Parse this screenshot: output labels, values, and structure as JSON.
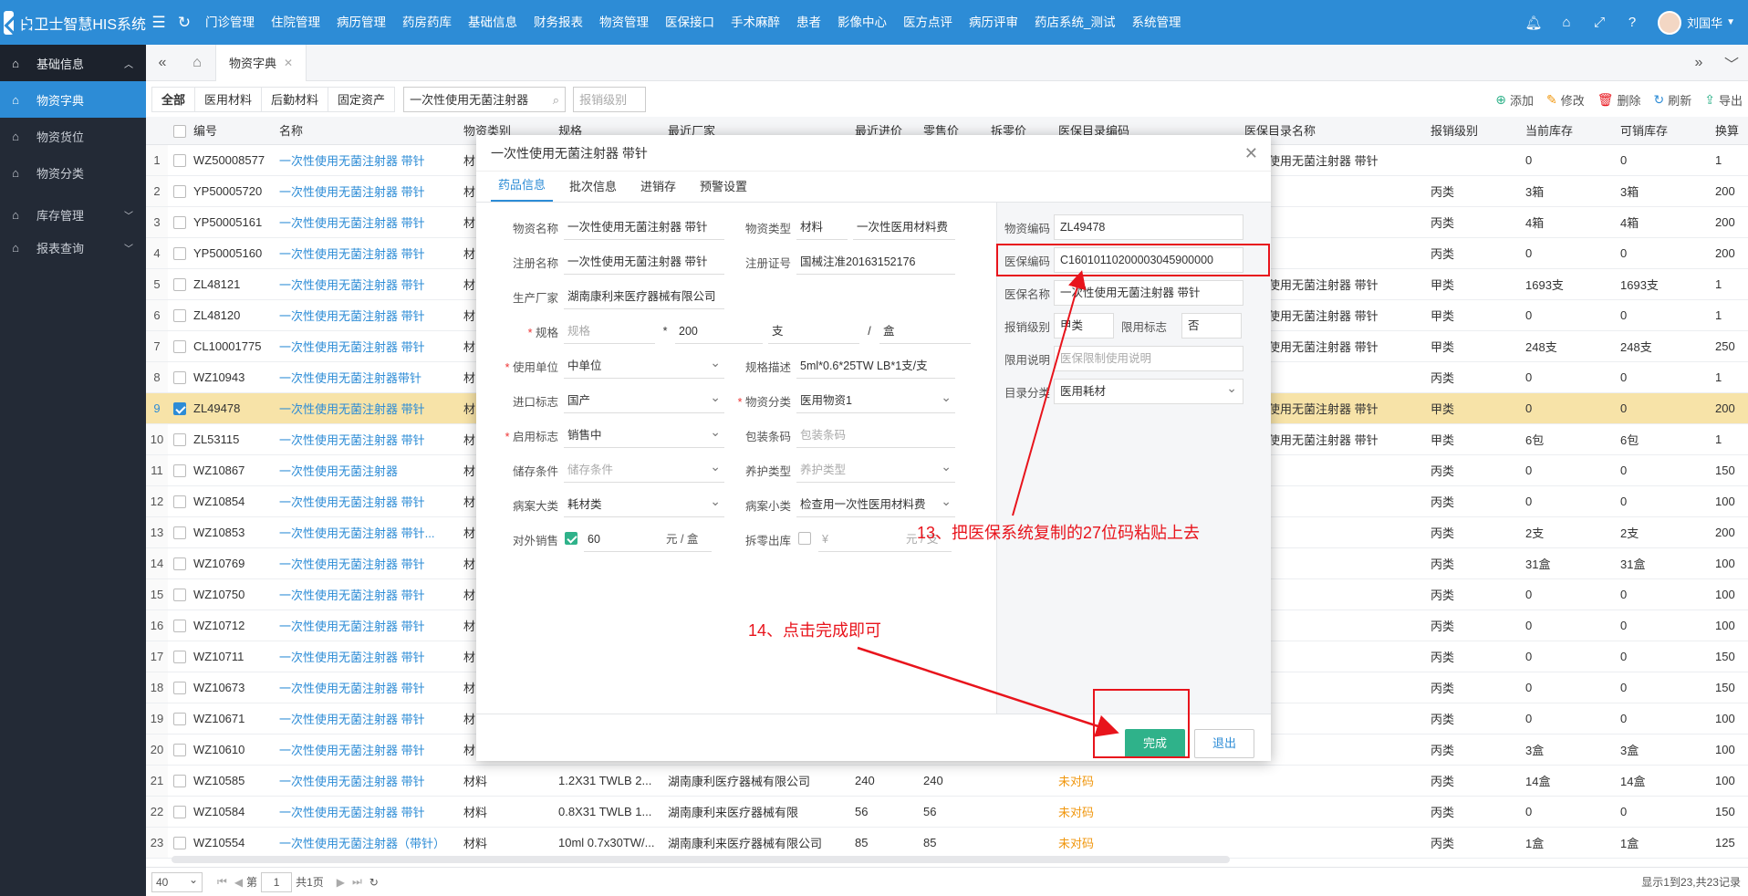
{
  "app": {
    "title": "白卫士智慧HIS系统",
    "user": "刘国华"
  },
  "topnav": [
    "门诊管理",
    "住院管理",
    "病历管理",
    "药房药库",
    "基础信息",
    "财务报表",
    "物资管理",
    "医保接口",
    "手术麻醉",
    "患者",
    "影像中心",
    "医方点评",
    "病历评审",
    "药店系统_测试",
    "系统管理"
  ],
  "sidebar": {
    "group1": "基础信息",
    "items": [
      "物资字典",
      "物资货位",
      "物资分类"
    ],
    "group2": "库存管理",
    "group3": "报表查询"
  },
  "tabstrip": {
    "page_tab": "物资字典"
  },
  "filter": {
    "tabs": [
      "全部",
      "医用材料",
      "后勤材料",
      "固定资产"
    ],
    "search_value": "一次性使用无菌注射器",
    "level_placeholder": "报销级别"
  },
  "toolbar": {
    "add": "添加",
    "edit": "修改",
    "delete": "删除",
    "refresh": "刷新",
    "export": "导出"
  },
  "grid": {
    "columns": [
      "编号",
      "名称",
      "物资类别",
      "规格",
      "最近厂家",
      "最近进价",
      "零售价",
      "拆零价",
      "医保目录编码",
      "医保目录名称",
      "报销级别",
      "当前库存",
      "可销库存",
      "换算"
    ],
    "rows": [
      {
        "idx": "1",
        "code": "WZ50008577",
        "name": "一次性使用无菌注射器 带针",
        "cat": "材",
        "spec": "",
        "maker": "",
        "cost": "",
        "price": "",
        "split": "",
        "ybcode": "",
        "ybname": "次性使用无菌注射器 带针",
        "level": "",
        "stock": "0",
        "avail": "0",
        "conv": "1"
      },
      {
        "idx": "2",
        "code": "YP50005720",
        "name": "一次性使用无菌注射器 带针",
        "cat": "材",
        "spec": "",
        "maker": "",
        "cost": "",
        "price": "",
        "split": "",
        "ybcode": "",
        "ybname": "",
        "level": "丙类",
        "stock": "3箱",
        "avail": "3箱",
        "conv": "200"
      },
      {
        "idx": "3",
        "code": "YP50005161",
        "name": "一次性使用无菌注射器 带针",
        "cat": "材",
        "spec": "",
        "maker": "",
        "cost": "",
        "price": "",
        "split": "",
        "ybcode": "",
        "ybname": "",
        "level": "丙类",
        "stock": "4箱",
        "avail": "4箱",
        "conv": "200"
      },
      {
        "idx": "4",
        "code": "YP50005160",
        "name": "一次性使用无菌注射器 带针",
        "cat": "材",
        "spec": "",
        "maker": "",
        "cost": "",
        "price": "",
        "split": "",
        "ybcode": "",
        "ybname": "",
        "level": "丙类",
        "stock": "0",
        "avail": "0",
        "conv": "200"
      },
      {
        "idx": "5",
        "code": "ZL48121",
        "name": "一次性使用无菌注射器 带针",
        "cat": "材",
        "spec": "",
        "maker": "",
        "cost": "",
        "price": "",
        "split": "",
        "ybcode": "",
        "ybname": "次性使用无菌注射器 带针",
        "level": "甲类",
        "stock": "1693支",
        "avail": "1693支",
        "conv": "1"
      },
      {
        "idx": "6",
        "code": "ZL48120",
        "name": "一次性使用无菌注射器 带针",
        "cat": "材",
        "spec": "",
        "maker": "",
        "cost": "",
        "price": "",
        "split": "",
        "ybcode": "",
        "ybname": "次性使用无菌注射器 带针",
        "level": "甲类",
        "stock": "0",
        "avail": "0",
        "conv": "1"
      },
      {
        "idx": "7",
        "code": "CL10001775",
        "name": "一次性使用无菌注射器 带针",
        "cat": "材",
        "spec": "",
        "maker": "",
        "cost": "",
        "price": "",
        "split": "",
        "ybcode": "",
        "ybname": "次性使用无菌注射器 带针",
        "level": "甲类",
        "stock": "248支",
        "avail": "248支",
        "conv": "250"
      },
      {
        "idx": "8",
        "code": "WZ10943",
        "name": "一次性使用无菌注射器带针",
        "cat": "材",
        "spec": "",
        "maker": "",
        "cost": "",
        "price": "",
        "split": "",
        "ybcode": "",
        "ybname": "",
        "level": "丙类",
        "stock": "0",
        "avail": "0",
        "conv": "1"
      },
      {
        "idx": "9",
        "code": "ZL49478",
        "name": "一次性使用无菌注射器 带针",
        "cat": "材",
        "spec": "",
        "maker": "",
        "cost": "",
        "price": "",
        "split": "",
        "ybcode": "",
        "ybname": "次性使用无菌注射器 带针",
        "level": "甲类",
        "stock": "0",
        "avail": "0",
        "conv": "200",
        "selected": true
      },
      {
        "idx": "10",
        "code": "ZL53115",
        "name": "一次性使用无菌注射器 带针",
        "cat": "材",
        "spec": "",
        "maker": "",
        "cost": "",
        "price": "",
        "split": "",
        "ybcode": "",
        "ybname": "次性使用无菌注射器 带针",
        "level": "甲类",
        "stock": "6包",
        "avail": "6包",
        "conv": "1"
      },
      {
        "idx": "11",
        "code": "WZ10867",
        "name": "一次性使用无菌注射器",
        "cat": "材",
        "spec": "",
        "maker": "",
        "cost": "",
        "price": "",
        "split": "",
        "ybcode": "",
        "ybname": "",
        "level": "丙类",
        "stock": "0",
        "avail": "0",
        "conv": "150"
      },
      {
        "idx": "12",
        "code": "WZ10854",
        "name": "一次性使用无菌注射器 带针",
        "cat": "材",
        "spec": "",
        "maker": "",
        "cost": "",
        "price": "",
        "split": "",
        "ybcode": "",
        "ybname": "",
        "level": "丙类",
        "stock": "0",
        "avail": "0",
        "conv": "100"
      },
      {
        "idx": "13",
        "code": "WZ10853",
        "name": "一次性使用无菌注射器 带针...",
        "cat": "材",
        "spec": "",
        "maker": "",
        "cost": "",
        "price": "",
        "split": "",
        "ybcode": "",
        "ybname": "",
        "level": "丙类",
        "stock": "2支",
        "avail": "2支",
        "conv": "200"
      },
      {
        "idx": "14",
        "code": "WZ10769",
        "name": "一次性使用无菌注射器 带针",
        "cat": "材",
        "spec": "",
        "maker": "",
        "cost": "",
        "price": "",
        "split": "",
        "ybcode": "",
        "ybname": "",
        "level": "丙类",
        "stock": "31盒",
        "avail": "31盒",
        "conv": "100"
      },
      {
        "idx": "15",
        "code": "WZ10750",
        "name": "一次性使用无菌注射器 带针",
        "cat": "材",
        "spec": "",
        "maker": "",
        "cost": "",
        "price": "",
        "split": "",
        "ybcode": "",
        "ybname": "",
        "level": "丙类",
        "stock": "0",
        "avail": "0",
        "conv": "100"
      },
      {
        "idx": "16",
        "code": "WZ10712",
        "name": "一次性使用无菌注射器 带针",
        "cat": "材",
        "spec": "",
        "maker": "",
        "cost": "",
        "price": "",
        "split": "",
        "ybcode": "",
        "ybname": "",
        "level": "丙类",
        "stock": "0",
        "avail": "0",
        "conv": "100"
      },
      {
        "idx": "17",
        "code": "WZ10711",
        "name": "一次性使用无菌注射器 带针",
        "cat": "材",
        "spec": "",
        "maker": "",
        "cost": "",
        "price": "",
        "split": "",
        "ybcode": "",
        "ybname": "",
        "level": "丙类",
        "stock": "0",
        "avail": "0",
        "conv": "150"
      },
      {
        "idx": "18",
        "code": "WZ10673",
        "name": "一次性使用无菌注射器 带针",
        "cat": "材",
        "spec": "",
        "maker": "",
        "cost": "",
        "price": "",
        "split": "",
        "ybcode": "",
        "ybname": "",
        "level": "丙类",
        "stock": "0",
        "avail": "0",
        "conv": "150"
      },
      {
        "idx": "19",
        "code": "WZ10671",
        "name": "一次性使用无菌注射器 带针",
        "cat": "材",
        "spec": "",
        "maker": "",
        "cost": "",
        "price": "",
        "split": "",
        "ybcode": "",
        "ybname": "",
        "level": "丙类",
        "stock": "0",
        "avail": "0",
        "conv": "100"
      },
      {
        "idx": "20",
        "code": "WZ10610",
        "name": "一次性使用无菌注射器 带针",
        "cat": "材",
        "spec": "",
        "maker": "",
        "cost": "",
        "price": "",
        "split": "",
        "ybcode": "",
        "ybname": "",
        "level": "丙类",
        "stock": "3盒",
        "avail": "3盒",
        "conv": "100"
      },
      {
        "idx": "21",
        "code": "WZ10585",
        "name": "一次性使用无菌注射器 带针",
        "cat": "材料",
        "spec": "1.2X31 TWLB 2...",
        "maker": "湖南康利医疗器械有限公司",
        "cost": "240",
        "price": "240",
        "split": "",
        "ybcode": "未对码",
        "ybname": "",
        "level": "丙类",
        "stock": "14盒",
        "avail": "14盒",
        "conv": "100"
      },
      {
        "idx": "22",
        "code": "WZ10584",
        "name": "一次性使用无菌注射器 带针",
        "cat": "材料",
        "spec": "0.8X31 TWLB 1...",
        "maker": "湖南康利来医疗器械有限",
        "cost": "56",
        "price": "56",
        "split": "",
        "ybcode": "未对码",
        "ybname": "",
        "level": "丙类",
        "stock": "0",
        "avail": "0",
        "conv": "150"
      },
      {
        "idx": "23",
        "code": "WZ10554",
        "name": "一次性使用无菌注射器（带针）",
        "cat": "材料",
        "spec": "10ml 0.7x30TW/...",
        "maker": "湖南康利来医疗器械有限公司",
        "cost": "85",
        "price": "85",
        "split": "",
        "ybcode": "未对码",
        "ybname": "",
        "level": "丙类",
        "stock": "1盒",
        "avail": "1盒",
        "conv": "125"
      }
    ]
  },
  "pager": {
    "page_size": "40",
    "page_prefix": "第",
    "page": "1",
    "page_total": "共1页",
    "info": "显示1到23,共23记录"
  },
  "modal": {
    "title": "一次性使用无菌注射器 带针",
    "tabs": [
      "药品信息",
      "批次信息",
      "进销存",
      "预警设置"
    ],
    "fields": {
      "name_label": "物资名称",
      "name_value": "一次性使用无菌注射器 带针",
      "type_label": "物资类型",
      "type_value": "材料",
      "type_value2": "一次性医用材料费",
      "reg_name_label": "注册名称",
      "reg_name_value": "一次性使用无菌注射器 带针",
      "reg_no_label": "注册证号",
      "reg_no_value": "国械注准20163152176",
      "maker_label": "生产厂家",
      "maker_value": "湖南康利来医疗器械有限公司",
      "spec_label": "规格",
      "spec_placeholder": "规格",
      "spec_mult": "*",
      "spec_qty": "200",
      "spec_unit": "支",
      "spec_slash": "/",
      "spec_pack": "盒",
      "use_unit_label": "使用单位",
      "use_unit_value": "中单位",
      "spec_desc_label": "规格描述",
      "spec_desc_value": "5ml*0.6*25TW LB*1支/支",
      "import_label": "进口标志",
      "import_value": "国产",
      "category_label": "物资分类",
      "category_value": "医用物资1",
      "enable_label": "启用标志",
      "enable_value": "销售中",
      "barcode_label": "包装条码",
      "barcode_placeholder": "包装条码",
      "storage_label": "储存条件",
      "storage_placeholder": "储存条件",
      "care_label": "养护类型",
      "care_placeholder": "养护类型",
      "case_big_label": "病案大类",
      "case_big_value": "耗材类",
      "case_small_label": "病案小类",
      "case_small_value": "检查用一次性医用材料费",
      "outsale_label": "对外销售",
      "outsale_price": "60",
      "outsale_unit": "元 / 盒",
      "split_label": "拆零出库",
      "split_prefix": "¥",
      "split_unit": "元 / 支"
    },
    "right": {
      "code_label": "物资编码",
      "code_value": "ZL49478",
      "yb_code_label": "医保编码",
      "yb_code_value": "C16010110200003045900000",
      "yb_name_label": "医保名称",
      "yb_name_value": "一次性使用无菌注射器 带针",
      "level_label": "报销级别",
      "level_value": "甲类",
      "limit_flag_label": "限用标志",
      "limit_flag_value": "否",
      "limit_desc_label": "限用说明",
      "limit_desc_placeholder": "医保限制使用说明",
      "dir_label": "目录分类",
      "dir_value": "医用耗材"
    },
    "done": "完成",
    "exit": "退出"
  },
  "annotations": {
    "step13": "13、把医保系统复制的27位码粘贴上去",
    "step14": "14、点击完成即可"
  },
  "colors": {
    "primary": "#2d8cd6",
    "sidebar": "#232a36",
    "done": "#2fb28a",
    "annotation": "#e8141c",
    "selected_row": "#f7e3a8"
  }
}
